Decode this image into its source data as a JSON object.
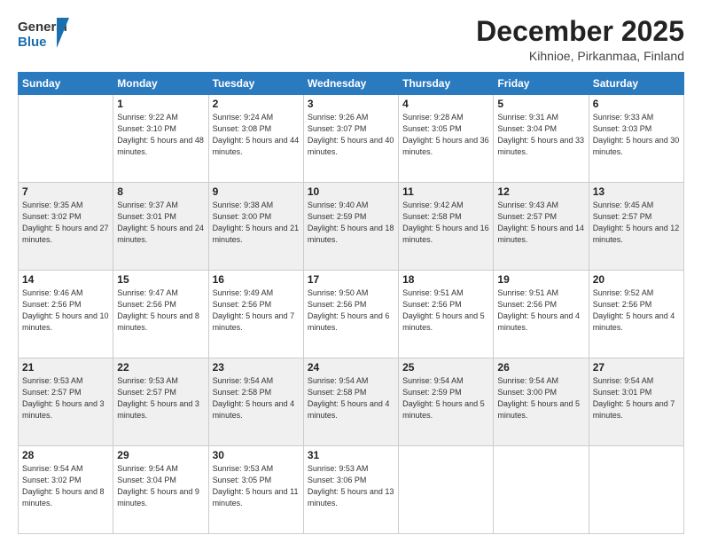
{
  "logo": {
    "line1": "General",
    "line2": "Blue"
  },
  "header": {
    "month": "December 2025",
    "location": "Kihnioe, Pirkanmaa, Finland"
  },
  "weekdays": [
    "Sunday",
    "Monday",
    "Tuesday",
    "Wednesday",
    "Thursday",
    "Friday",
    "Saturday"
  ],
  "weeks": [
    [
      {
        "day": "",
        "info": ""
      },
      {
        "day": "1",
        "info": "Sunrise: 9:22 AM\nSunset: 3:10 PM\nDaylight: 5 hours\nand 48 minutes."
      },
      {
        "day": "2",
        "info": "Sunrise: 9:24 AM\nSunset: 3:08 PM\nDaylight: 5 hours\nand 44 minutes."
      },
      {
        "day": "3",
        "info": "Sunrise: 9:26 AM\nSunset: 3:07 PM\nDaylight: 5 hours\nand 40 minutes."
      },
      {
        "day": "4",
        "info": "Sunrise: 9:28 AM\nSunset: 3:05 PM\nDaylight: 5 hours\nand 36 minutes."
      },
      {
        "day": "5",
        "info": "Sunrise: 9:31 AM\nSunset: 3:04 PM\nDaylight: 5 hours\nand 33 minutes."
      },
      {
        "day": "6",
        "info": "Sunrise: 9:33 AM\nSunset: 3:03 PM\nDaylight: 5 hours\nand 30 minutes."
      }
    ],
    [
      {
        "day": "7",
        "info": "Sunrise: 9:35 AM\nSunset: 3:02 PM\nDaylight: 5 hours\nand 27 minutes."
      },
      {
        "day": "8",
        "info": "Sunrise: 9:37 AM\nSunset: 3:01 PM\nDaylight: 5 hours\nand 24 minutes."
      },
      {
        "day": "9",
        "info": "Sunrise: 9:38 AM\nSunset: 3:00 PM\nDaylight: 5 hours\nand 21 minutes."
      },
      {
        "day": "10",
        "info": "Sunrise: 9:40 AM\nSunset: 2:59 PM\nDaylight: 5 hours\nand 18 minutes."
      },
      {
        "day": "11",
        "info": "Sunrise: 9:42 AM\nSunset: 2:58 PM\nDaylight: 5 hours\nand 16 minutes."
      },
      {
        "day": "12",
        "info": "Sunrise: 9:43 AM\nSunset: 2:57 PM\nDaylight: 5 hours\nand 14 minutes."
      },
      {
        "day": "13",
        "info": "Sunrise: 9:45 AM\nSunset: 2:57 PM\nDaylight: 5 hours\nand 12 minutes."
      }
    ],
    [
      {
        "day": "14",
        "info": "Sunrise: 9:46 AM\nSunset: 2:56 PM\nDaylight: 5 hours\nand 10 minutes."
      },
      {
        "day": "15",
        "info": "Sunrise: 9:47 AM\nSunset: 2:56 PM\nDaylight: 5 hours\nand 8 minutes."
      },
      {
        "day": "16",
        "info": "Sunrise: 9:49 AM\nSunset: 2:56 PM\nDaylight: 5 hours\nand 7 minutes."
      },
      {
        "day": "17",
        "info": "Sunrise: 9:50 AM\nSunset: 2:56 PM\nDaylight: 5 hours\nand 6 minutes."
      },
      {
        "day": "18",
        "info": "Sunrise: 9:51 AM\nSunset: 2:56 PM\nDaylight: 5 hours\nand 5 minutes."
      },
      {
        "day": "19",
        "info": "Sunrise: 9:51 AM\nSunset: 2:56 PM\nDaylight: 5 hours\nand 4 minutes."
      },
      {
        "day": "20",
        "info": "Sunrise: 9:52 AM\nSunset: 2:56 PM\nDaylight: 5 hours\nand 4 minutes."
      }
    ],
    [
      {
        "day": "21",
        "info": "Sunrise: 9:53 AM\nSunset: 2:57 PM\nDaylight: 5 hours\nand 3 minutes."
      },
      {
        "day": "22",
        "info": "Sunrise: 9:53 AM\nSunset: 2:57 PM\nDaylight: 5 hours\nand 3 minutes."
      },
      {
        "day": "23",
        "info": "Sunrise: 9:54 AM\nSunset: 2:58 PM\nDaylight: 5 hours\nand 4 minutes."
      },
      {
        "day": "24",
        "info": "Sunrise: 9:54 AM\nSunset: 2:58 PM\nDaylight: 5 hours\nand 4 minutes."
      },
      {
        "day": "25",
        "info": "Sunrise: 9:54 AM\nSunset: 2:59 PM\nDaylight: 5 hours\nand 5 minutes."
      },
      {
        "day": "26",
        "info": "Sunrise: 9:54 AM\nSunset: 3:00 PM\nDaylight: 5 hours\nand 5 minutes."
      },
      {
        "day": "27",
        "info": "Sunrise: 9:54 AM\nSunset: 3:01 PM\nDaylight: 5 hours\nand 7 minutes."
      }
    ],
    [
      {
        "day": "28",
        "info": "Sunrise: 9:54 AM\nSunset: 3:02 PM\nDaylight: 5 hours\nand 8 minutes."
      },
      {
        "day": "29",
        "info": "Sunrise: 9:54 AM\nSunset: 3:04 PM\nDaylight: 5 hours\nand 9 minutes."
      },
      {
        "day": "30",
        "info": "Sunrise: 9:53 AM\nSunset: 3:05 PM\nDaylight: 5 hours\nand 11 minutes."
      },
      {
        "day": "31",
        "info": "Sunrise: 9:53 AM\nSunset: 3:06 PM\nDaylight: 5 hours\nand 13 minutes."
      },
      {
        "day": "",
        "info": ""
      },
      {
        "day": "",
        "info": ""
      },
      {
        "day": "",
        "info": ""
      }
    ]
  ]
}
